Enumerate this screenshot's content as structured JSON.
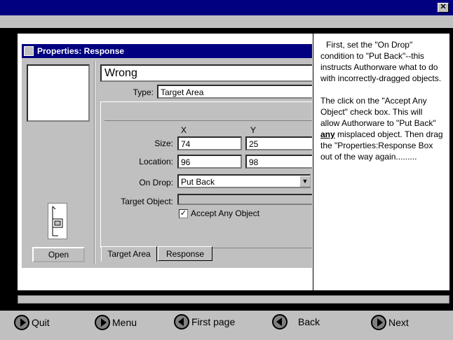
{
  "window": {
    "close_glyph": "✕"
  },
  "dialog": {
    "title": "Properties: Response",
    "response_name": "Wrong",
    "type_label": "Type:",
    "type_value": "Target Area",
    "col_x": "X",
    "col_y": "Y",
    "size_label": "Size:",
    "size_x": "74",
    "size_y": "25",
    "location_label": "Location:",
    "location_x": "96",
    "location_y": "98",
    "ondrop_label": "On Drop:",
    "ondrop_value": "Put Back",
    "target_object_label": "Target Object:",
    "accept_any_label": "Accept Any Object",
    "accept_any_checked": true,
    "open_button": "Open",
    "tabs": [
      "Target Area",
      "Response"
    ]
  },
  "instructions": {
    "p1": "First, set the \"On Drop\" condition to \"Put Back\"--this instructs Authorware what to do with incorrectly-dragged objects.",
    "p2_a": "The click on the \"Accept Any Object\" check box.  This will allow Authorware to \"Put Back\" ",
    "p2_emph": "any",
    "p2_b": " misplaced object. Then drag the \"Properties:Response Box out of the way again........."
  },
  "nav": {
    "quit": "Quit",
    "menu": "Menu",
    "first_page": "First page",
    "back": "Back",
    "next": "Next"
  }
}
